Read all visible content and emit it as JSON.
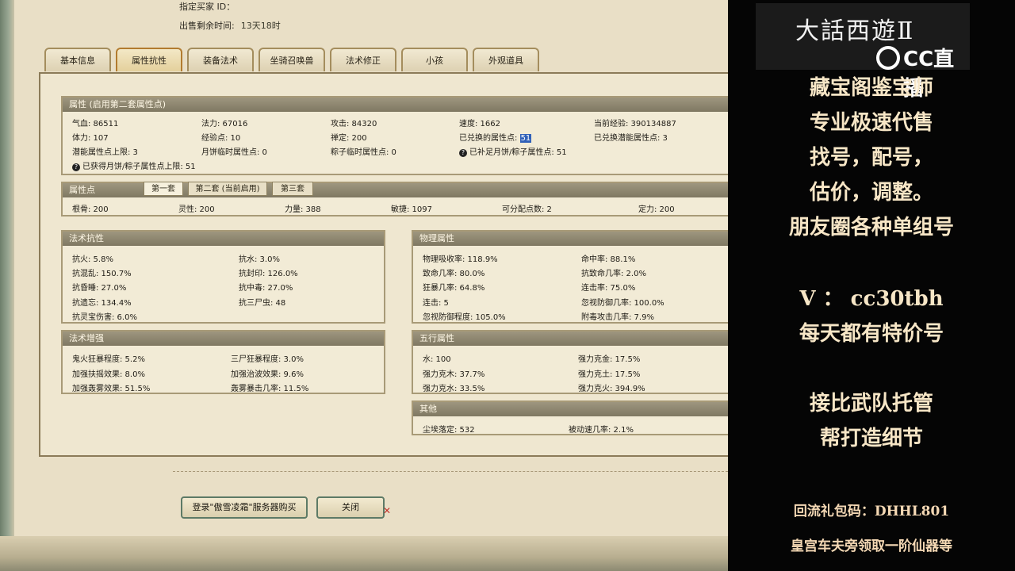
{
  "seller": {
    "buyer_id_label": "指定买家 ID：",
    "time_left_label": "出售剩余时间:",
    "time_left_value": "13天18时"
  },
  "tabs": [
    "基本信息",
    "属性抗性",
    "装备法术",
    "坐骑召唤兽",
    "法术修正",
    "小孩",
    "外观道具"
  ],
  "active_tab_index": 1,
  "attributes": {
    "title": "属性 (启用第二套属性点)",
    "row1": [
      "气血: 86511",
      "法力: 67016",
      "攻击: 84320",
      "速度: 1662",
      "当前经验: 390134887"
    ],
    "row2": [
      "体力: 107",
      "经验点: 10",
      "禅定: 200",
      "已兑换的属性点:",
      "已兑换潜能属性点: 3"
    ],
    "exchanged_points_value": "51",
    "row3": [
      "潜能属性点上限: 3",
      "月饼临时属性点: 0",
      "粽子临时属性点: 0",
      "已补足月饼/粽子属性点: 51"
    ],
    "row4": "已获得月饼/粽子属性点上限: 51"
  },
  "attr_points": {
    "title": "属性点",
    "sets": [
      "第一套",
      "第二套 (当前启用)",
      "第三套"
    ],
    "values": [
      "根骨: 200",
      "灵性: 200",
      "力量: 388",
      "敏捷: 1097",
      "可分配点数: 2",
      "定力: 200"
    ]
  },
  "spell_resist": {
    "title": "法术抗性",
    "items": [
      "抗火: 5.8%",
      "抗水: 3.0%",
      "抗混乱: 150.7%",
      "抗封印: 126.0%",
      "抗昏睡: 27.0%",
      "抗中毒: 27.0%",
      "抗遗忘: 134.4%",
      "抗三尸虫: 48",
      "抗灵宝伤害: 6.0%"
    ]
  },
  "spell_boost": {
    "title": "法术增强",
    "items": [
      "鬼火狂暴程度: 5.2%",
      "三尸狂暴程度: 3.0%",
      "加强扶摇效果: 8.0%",
      "加强治波效果: 9.6%",
      "加强轰雾效果: 51.5%",
      "轰雾暴击几率: 11.5%"
    ]
  },
  "physical": {
    "title": "物理属性",
    "items": [
      "物理吸收率: 118.9%",
      "命中率: 88.1%",
      "致命几率: 80.0%",
      "抗致命几率: 2.0%",
      "狂暴几率: 64.8%",
      "连击率: 75.0%",
      "连击: 5",
      "忽视防御几率: 100.0%",
      "忽视防御程度: 105.0%",
      "附毒攻击几率: 7.9%"
    ]
  },
  "five_elements": {
    "title": "五行属性",
    "items": [
      "水: 100",
      "强力克金: 17.5%",
      "强力克木: 37.7%",
      "强力克土: 17.5%",
      "强力克水: 33.5%",
      "强力克火: 394.9%"
    ]
  },
  "other": {
    "title": "其他",
    "items": [
      "尘埃落定: 532",
      "被动速几率: 2.1%"
    ]
  },
  "buttons": {
    "login_buy": "登录\"傲雪凌霜\"服务器购买",
    "close": "关闭"
  },
  "sidebar": {
    "logo": "大話西遊Ⅱ",
    "cc_logo": "CC直播",
    "lines": [
      "藏宝阁鉴宝师",
      "专业极速代售",
      "找号，配号，",
      "估价，调整。",
      "朋友圈各种单组号",
      "V ： cc30tbh",
      "每天都有特价号",
      "接比武队托管",
      "帮打造细节"
    ],
    "gift_code": "回流礼包码：DHHL801",
    "gift_note": "皇宫车夫旁领取一阶仙器等"
  }
}
